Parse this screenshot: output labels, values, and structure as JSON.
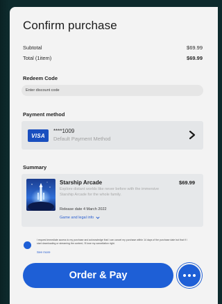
{
  "header": {
    "title": "Confirm purchase"
  },
  "totals": {
    "subtotal_label": "Subtotal",
    "subtotal_value": "$69.99",
    "total_label": "Total (1item)",
    "total_value": "$69.99"
  },
  "redeem": {
    "label": "Redeem Code",
    "placeholder": "Enter discount code"
  },
  "payment": {
    "label": "Payment method",
    "brand": "VISA",
    "card_number": "****1009",
    "card_subtitle": "Default Payment Method"
  },
  "summary": {
    "label": "Summary",
    "game_name": "Starship Arcade",
    "price": "$69.99",
    "description": "Explore distant worlds like never before with the immersive Starship Arcade for the whole family.",
    "release": "Release date 4 March 2022",
    "legal_link": "Game and legal info"
  },
  "consent": {
    "text": "I request immediate access to my purchase and acknowledge that I can cancel my purchase within 14 days of the purchase date but that if I start downloading or streaming the content, I'll lose my cancellation right.",
    "see_more": "See more"
  },
  "actions": {
    "order_label": "Order & Pay"
  },
  "colors": {
    "accent": "#1e5fd6",
    "panel": "#f3f3f3",
    "backdrop": "#0d2a2c",
    "visa": "#1a4fbf"
  },
  "icons": [
    "chevron-right-icon",
    "chevron-down-icon",
    "more-dots-icon",
    "game-cover-art"
  ]
}
